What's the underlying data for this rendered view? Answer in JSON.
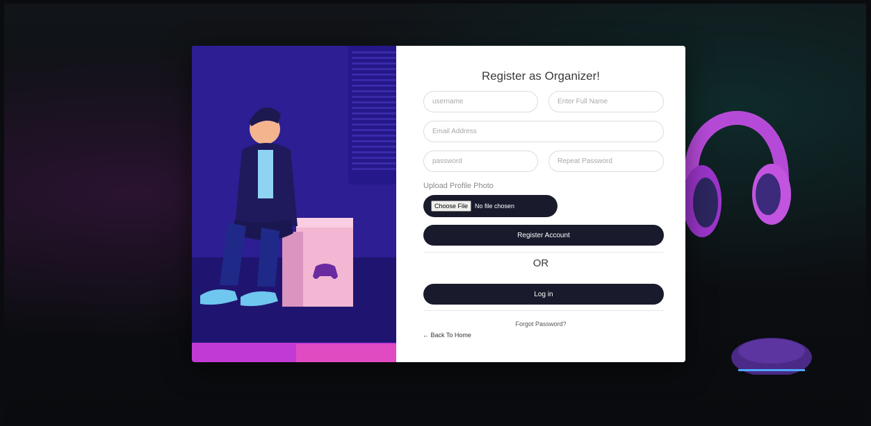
{
  "form": {
    "title": "Register as Organizer!",
    "username_placeholder": "username",
    "fullname_placeholder": "Enter Full Name",
    "email_placeholder": "Email Address",
    "password_placeholder": "password",
    "repeat_password_placeholder": "Repeat Password",
    "upload_label": "Upload Profile Photo",
    "file_button": "Choose File",
    "file_status": "No file chosen",
    "register_button": "Register Account",
    "or_text": "OR",
    "login_button": "Log in",
    "forgot_link": "Forgot Password?",
    "back_link": "← Back To Home"
  },
  "colors": {
    "button_bg": "#191b2c",
    "illustration_primary": "#3a1aa0",
    "accent_pink": "#e040c8"
  },
  "icons": {
    "back": "left-arrow-icon"
  }
}
